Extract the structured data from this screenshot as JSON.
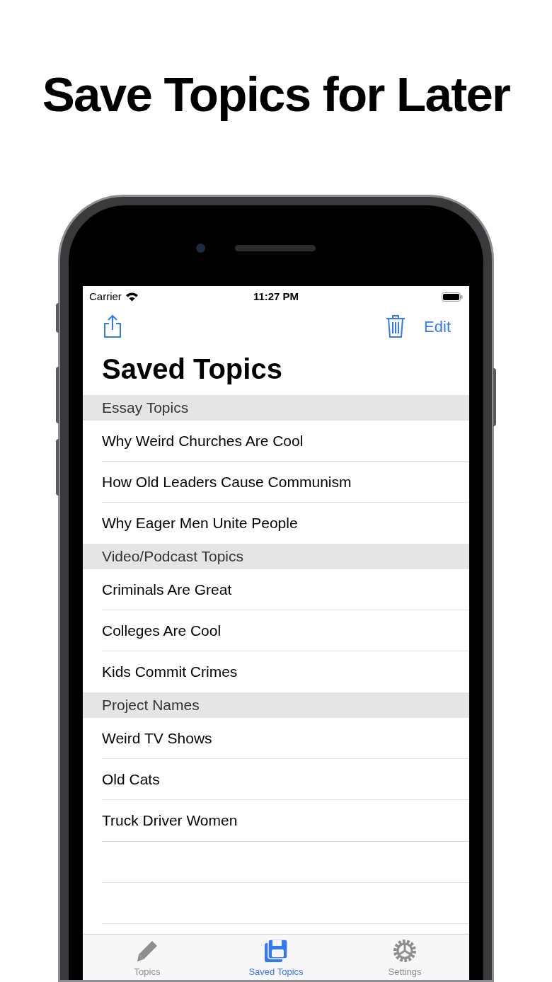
{
  "headline": "Save Topics for Later",
  "status_bar": {
    "carrier": "Carrier",
    "time": "11:27 PM"
  },
  "nav": {
    "edit": "Edit"
  },
  "title": "Saved Topics",
  "sections": [
    {
      "header": "Essay Topics",
      "rows": [
        "Why Weird Churches Are Cool",
        "How Old Leaders Cause Communism",
        "Why Eager Men Unite People"
      ]
    },
    {
      "header": "Video/Podcast Topics",
      "rows": [
        "Criminals Are Great",
        "Colleges Are Cool",
        "Kids Commit Crimes"
      ]
    },
    {
      "header": "Project Names",
      "rows": [
        "Weird TV Shows",
        "Old Cats",
        "Truck Driver Women"
      ]
    }
  ],
  "tabs": [
    {
      "label": "Topics",
      "kind": "pencil",
      "selected": false
    },
    {
      "label": "Saved Topics",
      "kind": "disk",
      "selected": true
    },
    {
      "label": "Settings",
      "kind": "gear",
      "selected": false
    }
  ]
}
